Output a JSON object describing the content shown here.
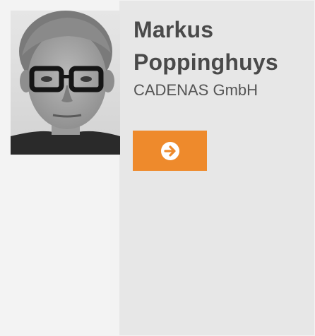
{
  "profile": {
    "first_name": "Markus",
    "last_name": "Poppinghuys",
    "company": "CADENAS GmbH",
    "photo_icon": "person-portrait-photo"
  },
  "action": {
    "icon": "arrow-right-circle-icon",
    "button_color": "#ee8a2c",
    "icon_color": "#ffffff"
  },
  "colors": {
    "left_panel": "#f3f3f3",
    "right_panel": "#e7e7e7",
    "name_text": "#4a4a4a",
    "company_text": "#555555"
  }
}
